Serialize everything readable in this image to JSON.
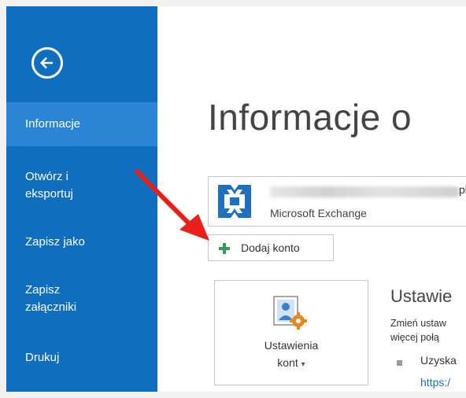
{
  "sidebar": {
    "items": [
      {
        "label": "Informacje",
        "active": true
      },
      {
        "label_line1": "Otwórz i",
        "label_line2": "eksportuj"
      },
      {
        "label": "Zapisz jako"
      },
      {
        "label_line1": "Zapisz",
        "label_line2": "załączniki"
      },
      {
        "label": "Drukuj"
      }
    ],
    "background_color": "#106ebe",
    "active_color": "#2c84d4"
  },
  "main": {
    "title": "Informacje o",
    "account": {
      "email_suffix": "pl",
      "type": "Microsoft Exchange"
    },
    "add_account_label": "Dodaj konto",
    "settings_tile": {
      "label_line1": "Ustawienia",
      "label_line2": "kont",
      "dropdown_glyph": "▾"
    },
    "section": {
      "title": "Ustawie",
      "desc_line1": "Zmień ustaw",
      "desc_line2": "więcej połą",
      "bullet_text": "Uzyska",
      "link_text": "https:/"
    }
  },
  "icons": {
    "back": "back-arrow-icon",
    "exchange": "exchange-logo-icon",
    "add": "plus-icon",
    "settings": "account-settings-icon",
    "annotation": "red-arrow-annotation"
  },
  "colors": {
    "accent": "#106ebe",
    "add_icon": "#3a9a5b",
    "annotation_arrow": "#e8201c"
  }
}
